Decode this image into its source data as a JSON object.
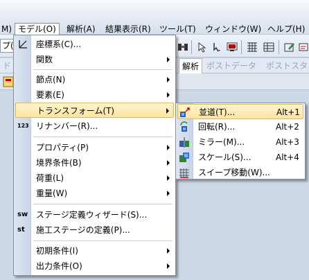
{
  "menubar": {
    "items": [
      {
        "label": "M)"
      },
      {
        "label": "モデル(O)"
      },
      {
        "label": "解析(A)"
      },
      {
        "label": "結果表示(R)"
      },
      {
        "label": "ツール(T)"
      },
      {
        "label": "ウィンドウ(W)"
      },
      {
        "label": "ヘルプ(H)"
      }
    ]
  },
  "toolbar": {
    "left_fragment": "プ("
  },
  "ribbon": {
    "left_fragment": "ド",
    "tabs": [
      {
        "label": "解析"
      },
      {
        "label": "ポストデータ"
      },
      {
        "label": "ポストスタ"
      }
    ]
  },
  "menu": {
    "items": [
      {
        "label": "座標系(C)...",
        "icon": "axis-icon"
      },
      {
        "label": "関数"
      },
      {
        "label": "節点(N)"
      },
      {
        "label": "要素(E)"
      },
      {
        "label": "トランスフォーム(T)"
      },
      {
        "label": "リナンバー(R)...",
        "icon_text": "123"
      },
      {
        "label": "プロパティ(P)"
      },
      {
        "label": "境界条件(B)"
      },
      {
        "label": "荷重(L)"
      },
      {
        "label": "重量(W)"
      },
      {
        "label": "ステージ定義ウィザード(S)...",
        "icon_text": "sw"
      },
      {
        "label": "施工ステージの定義(P)...",
        "icon_text": "st"
      },
      {
        "label": "初期条件(I)"
      },
      {
        "label": "出力条件(O)"
      }
    ]
  },
  "submenu": {
    "items": [
      {
        "label": "並道(T)...",
        "shortcut": "Alt+1",
        "icon": "translate-icon"
      },
      {
        "label": "回転(R)...",
        "shortcut": "Alt+2",
        "icon": "rotate-icon"
      },
      {
        "label": "ミラー(M)...",
        "shortcut": "Alt+3",
        "icon": "mirror-icon"
      },
      {
        "label": "スケール(S)...",
        "shortcut": "Alt+4",
        "icon": "scale-icon"
      },
      {
        "label": "スイープ移動(W)...",
        "icon": "sweep-icon"
      }
    ]
  }
}
